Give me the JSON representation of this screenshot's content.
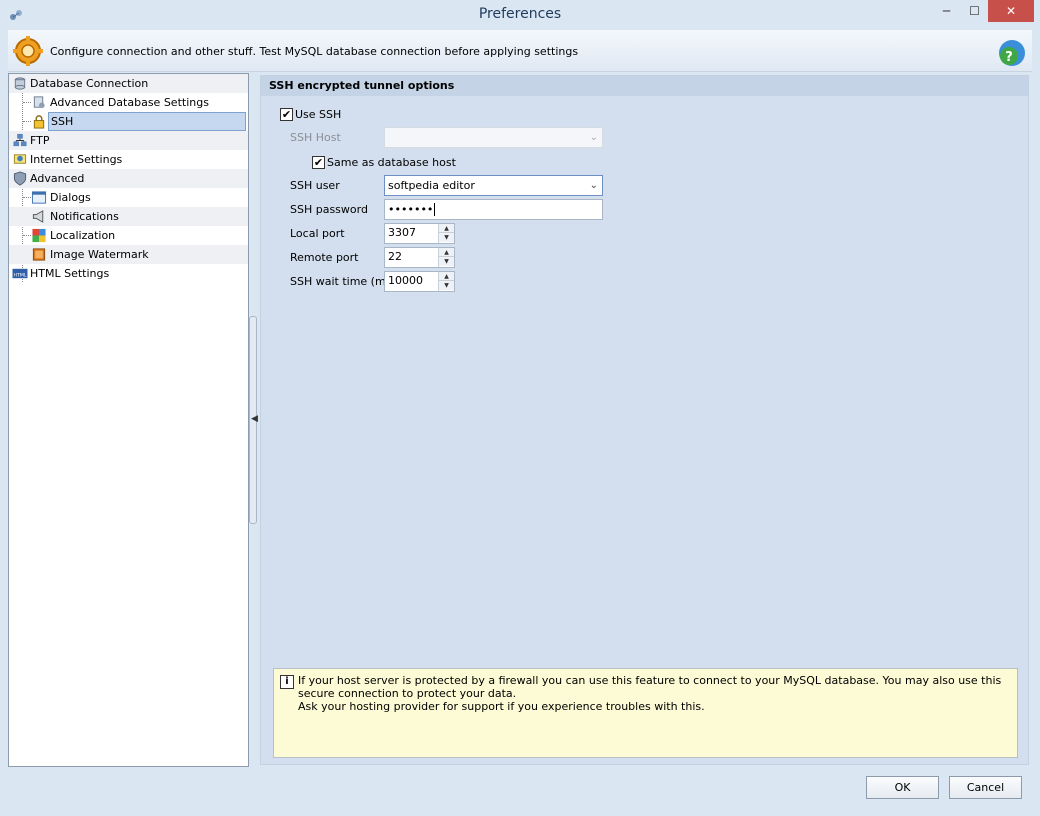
{
  "window": {
    "title": "Preferences"
  },
  "header": {
    "description": "Configure connection and other stuff. Test MySQL database connection before applying settings"
  },
  "tree": {
    "items": [
      {
        "label": "Database Connection",
        "icon": "database-icon"
      },
      {
        "label": "Advanced Database Settings",
        "icon": "database-settings-icon"
      },
      {
        "label": "SSH",
        "icon": "lock-icon",
        "selected": true
      },
      {
        "label": "FTP",
        "icon": "network-icon"
      },
      {
        "label": "Internet Settings",
        "icon": "internet-settings-icon"
      },
      {
        "label": "Advanced",
        "icon": "shield-icon"
      },
      {
        "label": "Dialogs",
        "icon": "dialog-icon"
      },
      {
        "label": "Notifications",
        "icon": "megaphone-icon"
      },
      {
        "label": "Localization",
        "icon": "puzzle-icon"
      },
      {
        "label": "Image Watermark",
        "icon": "image-icon"
      },
      {
        "label": "HTML Settings",
        "icon": "html-icon"
      }
    ]
  },
  "panel": {
    "title": "SSH encrypted tunnel options",
    "use_ssh_label": "Use SSH",
    "use_ssh_checked": true,
    "ssh_host_label": "SSH Host",
    "ssh_host_value": "",
    "same_as_db_label": "Same as database host",
    "same_as_db_checked": true,
    "ssh_user_label": "SSH user",
    "ssh_user_value": "softpedia editor",
    "ssh_password_label": "SSH password",
    "ssh_password_value": "•••••••",
    "local_port_label": "Local port",
    "local_port_value": "3307",
    "remote_port_label": "Remote port",
    "remote_port_value": "22",
    "wait_time_label": "SSH wait time (ms)",
    "wait_time_value": "10000"
  },
  "info": {
    "line1": "If your host server is protected by a firewall you can use this feature to connect to your MySQL database. You may also use this secure connection to protect your data.",
    "line2": "Ask your hosting provider for support if you experience troubles with this."
  },
  "buttons": {
    "ok": "OK",
    "cancel": "Cancel"
  }
}
